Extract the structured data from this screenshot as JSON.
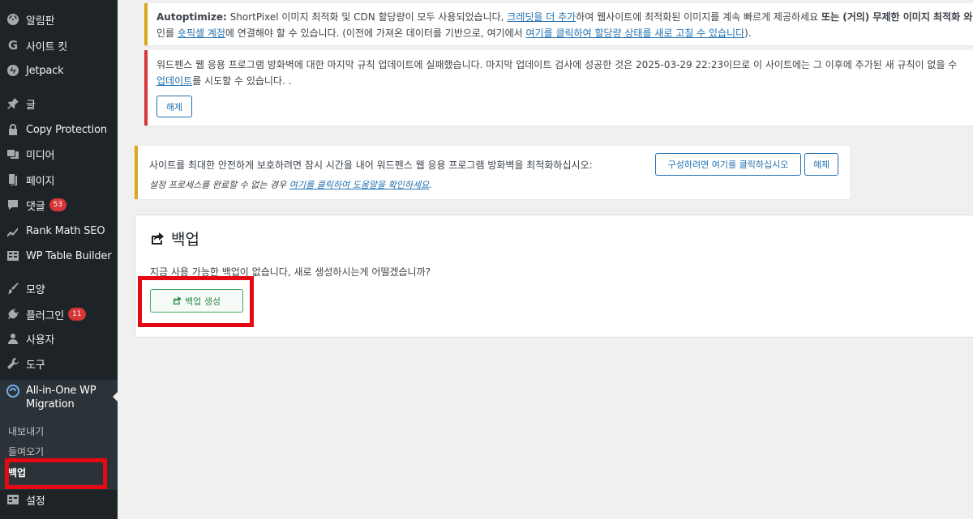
{
  "sidebar": {
    "items": [
      {
        "label": "알림판",
        "icon": "dashboard-icon"
      },
      {
        "label": "사이트 킷",
        "icon": "site-kit-g-icon"
      },
      {
        "label": "Jetpack",
        "icon": "jetpack-icon"
      },
      {
        "label": "글",
        "icon": "pin-icon"
      },
      {
        "label": "Copy Protection",
        "icon": "lock-icon"
      },
      {
        "label": "미디어",
        "icon": "media-icon"
      },
      {
        "label": "페이지",
        "icon": "page-icon"
      },
      {
        "label": "댓글",
        "icon": "comment-icon",
        "badge": "53"
      },
      {
        "label": "Rank Math SEO",
        "icon": "rank-math-icon"
      },
      {
        "label": "WP Table Builder",
        "icon": "table-icon"
      },
      {
        "label": "모양",
        "icon": "brush-icon"
      },
      {
        "label": "플러그인",
        "icon": "plugin-icon",
        "badge": "11"
      },
      {
        "label": "사용자",
        "icon": "user-icon"
      },
      {
        "label": "도구",
        "icon": "wrench-icon"
      }
    ],
    "current": {
      "label": "All-in-One WP Migration",
      "icon": "migration-icon"
    },
    "submenu": [
      {
        "label": "내보내기"
      },
      {
        "label": "들여오기"
      },
      {
        "label": "백업"
      }
    ],
    "settings": {
      "label": "설정",
      "icon": "settings-icon"
    }
  },
  "notices": {
    "autoptimize": {
      "brand": "Autoptimize:",
      "l1_a": " ShortPixel 이미지 최적화 및 CDN 할당량이 모두 사용되었습니다, ",
      "l1_link": "크레딧을 더 추가",
      "l1_b": "하여 웹사이트에 최적화된 이미지를 계속 빠르게 제공하세요 ",
      "l1_bold": "또는 (거의) 무제한 이미지 최적화 와",
      "l2_a": "인를 ",
      "l2_link1": "숏픽셀 계정",
      "l2_b": "에 연결해야 할 수 있습니다. (이전에 가져온 데이터를 기반으로, 여기에서 ",
      "l2_link2": "여기를 클릭하여 할당량 상태를 새로 고칠 수 있습니다",
      "l2_c": ")."
    },
    "firewall_update": {
      "l1": "워드펜스 웹 응용 프로그램 방화벽에 대한 마지막 규칙 업데이트에 실패했습니다. 마지막 업데이트 검사에 성공한 것은 2025-03-29 22:23이므로 이 사이트에는 그 이후에 추가된 새 규칙이 없을 수",
      "l2_link": "업데이트",
      "l2_b": "를 시도할 수 있습니다. .",
      "dismiss": "해제"
    },
    "firewall_optimize": {
      "l1": "사이트를 최대한 안전하게 보호하려면 잠시 시간을 내어 워드펜스 웹 응용 프로그램 방화벽을 최적화하십시오:",
      "configure": "구성하려면 여기를 클릭하십시오",
      "dismiss": "해제",
      "l2_a": "설정 프로세스를 완료할 수 없는 경우 ",
      "l2_link": "여기를 클릭하여 도움말을 확인하세요",
      "l2_b": "."
    }
  },
  "backup": {
    "title": "백업",
    "message": "지금 사용 가능한 백업이 없습니다, 새로 생성하시는게 어떨겠습니까?",
    "create_label": "백업 생성"
  },
  "colors": {
    "highlight": "#e50914",
    "accent": "#2271b1",
    "success": "#2c8a47"
  }
}
